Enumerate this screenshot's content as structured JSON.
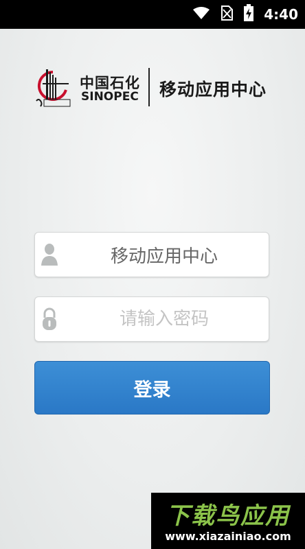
{
  "status_bar": {
    "time": "4:40",
    "icons": [
      "wifi-icon",
      "no-sim-icon",
      "battery-charging-icon"
    ]
  },
  "header": {
    "brand_cn": "中国石化",
    "brand_en": "SINOPEC",
    "app_title": "移动应用中心"
  },
  "login_form": {
    "username": {
      "value": "移动应用中心",
      "icon": "user-icon"
    },
    "password": {
      "placeholder": "请输入密码",
      "icon": "lock-icon"
    },
    "submit_label": "登录"
  },
  "watermark": {
    "title": "下载鸟应用",
    "url": "www.xiazainiao.com"
  },
  "colors": {
    "primary_button": "#2f80cc",
    "background": "#eceeee",
    "watermark_green": "#8bc34a"
  }
}
